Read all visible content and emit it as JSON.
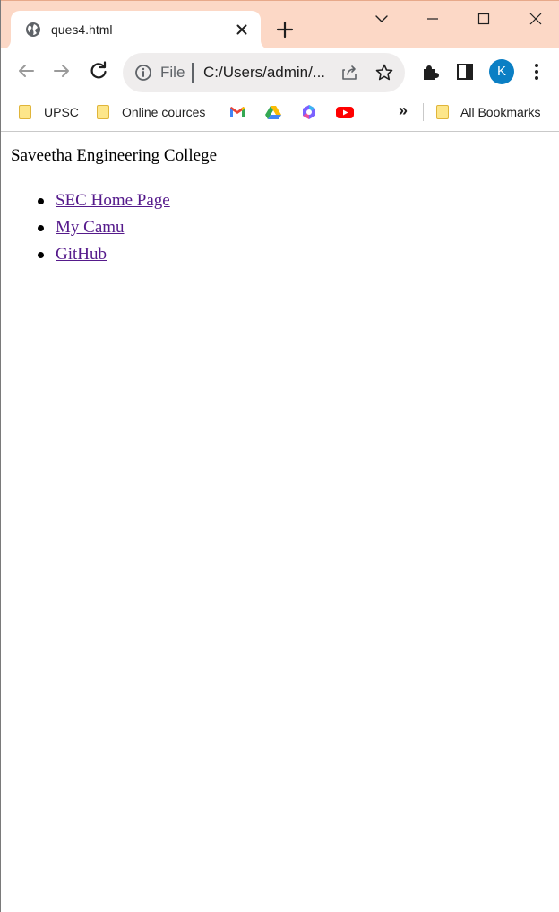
{
  "tab": {
    "title": "ques4.html",
    "favicon": "globe-icon"
  },
  "toolbar": {
    "scheme_label": "File",
    "url": "C:/Users/admin/...",
    "profile_initial": "K",
    "profile_color": "#0b7fc4"
  },
  "bookmarks": {
    "items": [
      {
        "label": "UPSC",
        "icon": "folder-icon"
      },
      {
        "label": "Online cources",
        "icon": "folder-icon"
      },
      {
        "label": "",
        "icon": "gmail-icon"
      },
      {
        "label": "",
        "icon": "google-drive-icon"
      },
      {
        "label": "",
        "icon": "copilot-icon"
      },
      {
        "label": "",
        "icon": "youtube-icon"
      }
    ],
    "overflow": "»",
    "all_bookmarks": "All Bookmarks"
  },
  "page": {
    "heading": "Saveetha Engineering College",
    "links": [
      {
        "label": "SEC Home Page"
      },
      {
        "label": "My Camu"
      },
      {
        "label": "GitHub"
      }
    ],
    "link_color": "#551a8b"
  },
  "colors": {
    "titlebar": "#fcd8c6",
    "accent": "#0b7fc4"
  }
}
